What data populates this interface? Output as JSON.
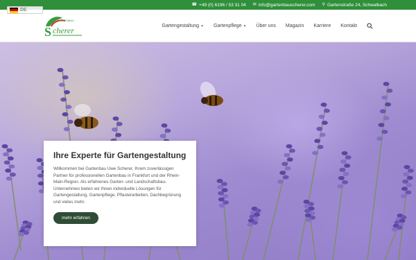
{
  "language": {
    "code": "DE",
    "flag_colors": [
      "#000000",
      "#dd0000",
      "#ffce00"
    ]
  },
  "topbar": {
    "phone_icon": "phone-icon",
    "phone": "+49 (0) 6196 / 53 31 04",
    "email_icon": "envelope-icon",
    "email": "info@gartenbauscherer.com",
    "address_icon": "map-pin-icon",
    "address": "Gartenstraße 24, Schwalbach"
  },
  "logo": {
    "top_text": "GARTENBAU",
    "name": "Scherer"
  },
  "nav": {
    "items": [
      {
        "label": "Gartengestaltung",
        "has_dropdown": true
      },
      {
        "label": "Gartenpflege",
        "has_dropdown": true
      },
      {
        "label": "Über uns",
        "has_dropdown": false
      },
      {
        "label": "Magazin",
        "has_dropdown": false
      },
      {
        "label": "Karriere",
        "has_dropdown": false
      },
      {
        "label": "Kontakt",
        "has_dropdown": false
      }
    ],
    "search_icon": "search-icon"
  },
  "card": {
    "title": "Ihre Experte für Gartengestaltung",
    "text": "Willkommen bei Gartenbau Uwe Scherer, Ihrem zuverlässigen Partner für professionellen Gartenbau in Frankfurt und der Rhein-Main-Region. Als erfahrenes Garten- und Landschaftsbau-Unternehmen bieten wir Ihnen individuelle Lösungen für Gartengestaltung, Gartenpflege, Pflasterarbeiten, Dachbegrünung und vieles mehr.",
    "button": "mehr erfahren"
  },
  "colors": {
    "topbar": "#2f8f3a",
    "button": "#2f4d35",
    "logo_green": "#3d9a3f",
    "logo_red": "#d62b2b",
    "lavender": "#6b55b0"
  }
}
